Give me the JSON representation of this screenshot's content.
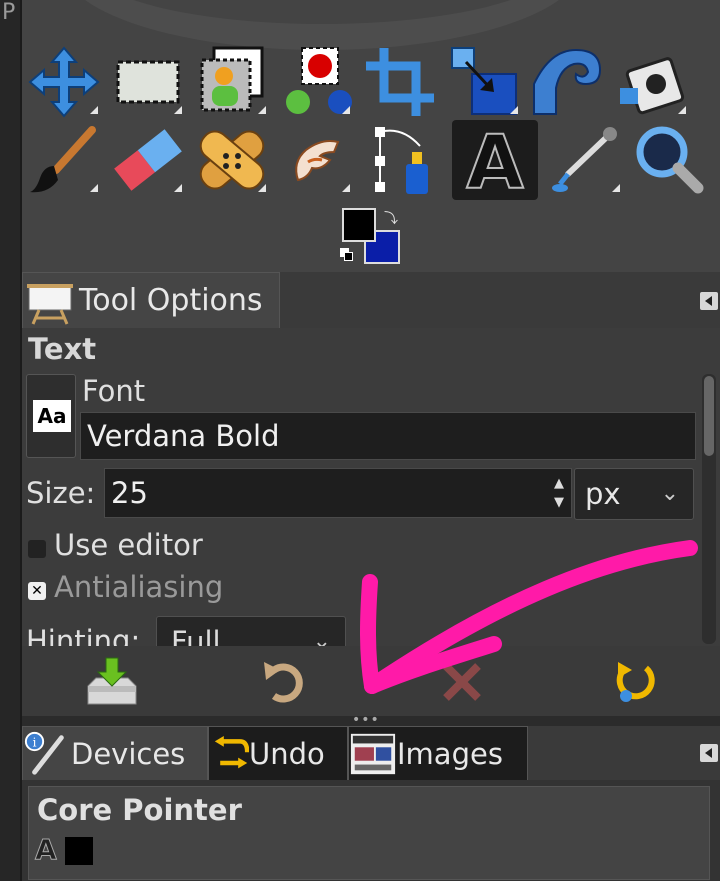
{
  "window_fragment": "P",
  "tool_options": {
    "tab_label": "Tool Options",
    "tool_name": "Text",
    "font_label": "Font",
    "font_value": "Verdana Bold",
    "font_preview_glyph": "Aa",
    "size_label": "Size:",
    "size_value": "25",
    "unit_value": "px",
    "use_editor_label": "Use editor",
    "antialiasing_label": "Antialiasing",
    "hinting_label": "Hinting:",
    "hinting_value": "Full"
  },
  "bottom_tabs": {
    "devices": "Devices",
    "undo": "Undo",
    "images": "Images"
  },
  "devices_panel": {
    "title": "Core Pointer",
    "tool_glyph": "A"
  },
  "colors": {
    "annotation_arrow": "#ff1aa8",
    "foreground": "#000000",
    "background": "#0a1ea8"
  },
  "icons": {
    "row1": [
      "move-icon",
      "rect-select-icon",
      "foreground-select-icon",
      "color-picker-select-icon",
      "crop-icon",
      "scale-icon",
      "warp-icon",
      "paths-stamp-icon"
    ],
    "row2": [
      "paintbrush-icon",
      "eraser-icon",
      "heal-icon",
      "smudge-icon",
      "paths-icon",
      "text-icon",
      "color-picker-icon",
      "zoom-icon"
    ]
  }
}
